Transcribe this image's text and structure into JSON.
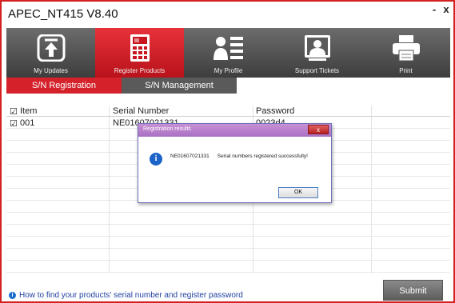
{
  "window": {
    "title": "APEC_NT415  V8.40",
    "minimize": "-",
    "close": "x"
  },
  "toolbar": {
    "items": [
      {
        "label": "My Updates",
        "icon": "upload-icon"
      },
      {
        "label": "Register Products",
        "icon": "calculator-icon"
      },
      {
        "label": "My Profile",
        "icon": "profile-icon"
      },
      {
        "label": "Support Tickets",
        "icon": "ticket-icon"
      },
      {
        "label": "Print",
        "icon": "printer-icon"
      }
    ]
  },
  "tabs": [
    {
      "label": "S/N Registration"
    },
    {
      "label": "S/N Management"
    }
  ],
  "table": {
    "headers": [
      "Item",
      "Serial Number",
      "Password"
    ],
    "header_check": "☑",
    "rows": [
      {
        "check": "☑",
        "item": "001",
        "serial": "NE01607021331",
        "password": "0023d4"
      }
    ]
  },
  "dialog": {
    "title": "Registration results",
    "close": "x",
    "icon": "i",
    "serial": "NE01607021331",
    "message": "Serial numbers registered successfully!",
    "ok": "OK"
  },
  "footer": {
    "info_icon": "i",
    "link": "How to find your products' serial number and register password",
    "submit": "Submit"
  },
  "colors": {
    "accent": "#d4212a",
    "toolbar": "#4a4a4a",
    "link": "#1e3fa0"
  }
}
